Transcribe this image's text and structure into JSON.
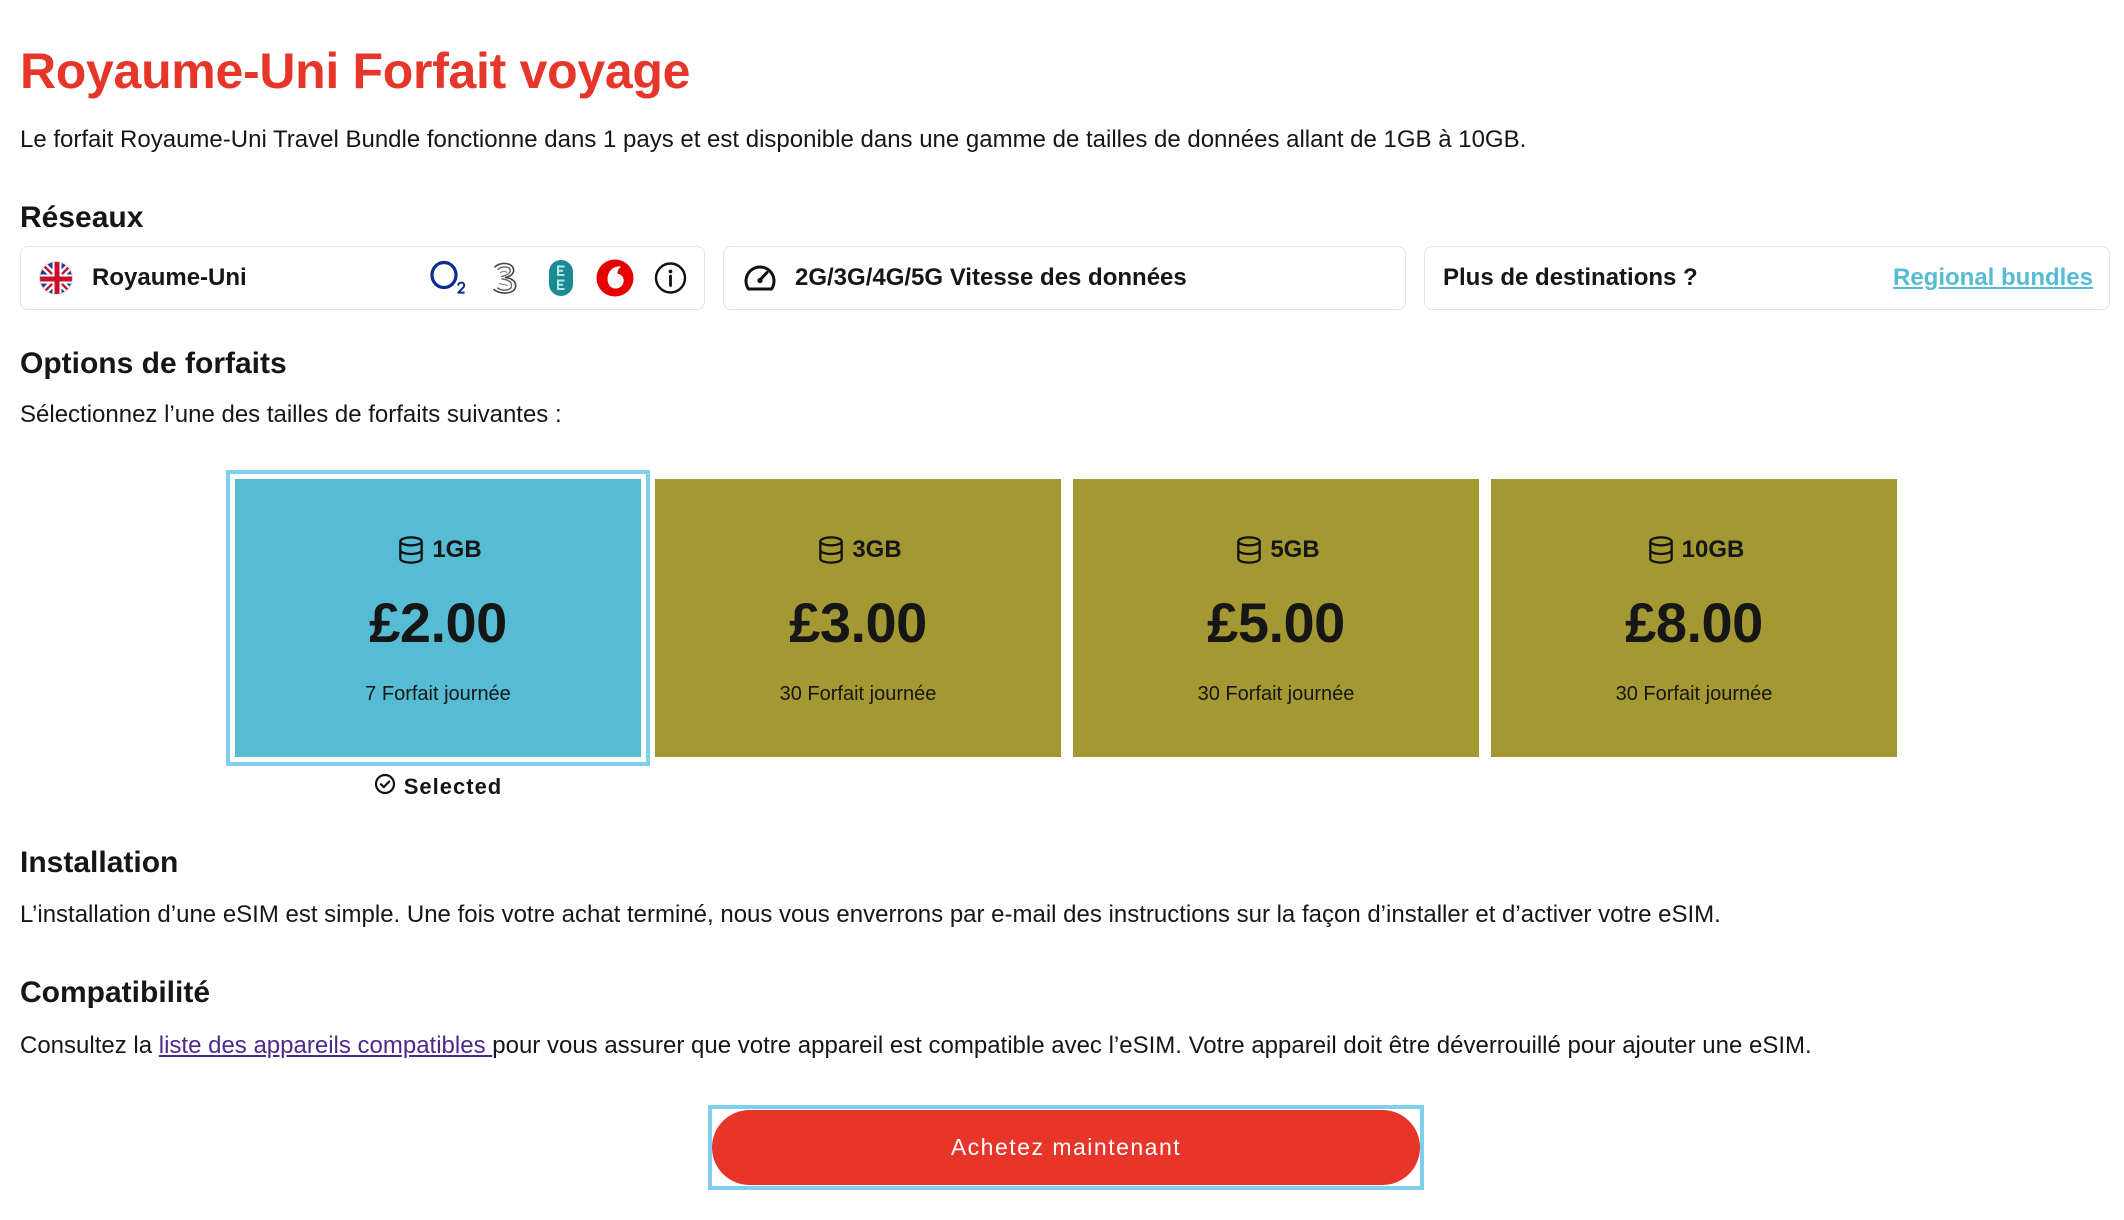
{
  "page": {
    "title": "Royaume-Uni Forfait voyage",
    "description": "Le forfait Royaume-Uni Travel Bundle fonctionne dans 1 pays et est disponible dans une gamme de tailles de données allant de 1GB à 10GB."
  },
  "colors": {
    "title_red": "#e6362a",
    "button_red": "#e8352a",
    "selected_plan": "#56bcd4",
    "plan_default": "#a49833",
    "focus_outline": "#7fd0ee",
    "regional_link": "#56bcd4",
    "compat_link": "#4c2a8a"
  },
  "networks": {
    "heading": "Réseaux",
    "country": "Royaume-Uni",
    "country_flag_icon": "uk-flag-icon",
    "operators": [
      {
        "icon": "o2-logo-icon",
        "logo_text": "O2"
      },
      {
        "icon": "three-logo-icon",
        "logo_text": "3"
      },
      {
        "icon": "ee-logo-icon",
        "logo_text": "EE"
      },
      {
        "icon": "vodafone-logo-icon"
      }
    ],
    "info_icon": "info-icon",
    "speed_icon": "speedometer-icon",
    "speed_label": "2G/3G/4G/5G Vitesse des données",
    "more_label": "Plus de destinations ?",
    "regional_link": "Regional bundles"
  },
  "plans": {
    "heading": "Options de forfaits",
    "instruction": "Sélectionnez l’une des tailles de forfaits suivantes :",
    "size_icon": "database-icon",
    "selected_index": 0,
    "selected_label": "Selected",
    "selected_icon": "check-circle-icon",
    "items": [
      {
        "size": "1GB",
        "price": "£2.00",
        "validity": "7 Forfait journée"
      },
      {
        "size": "3GB",
        "price": "£3.00",
        "validity": "30 Forfait journée"
      },
      {
        "size": "5GB",
        "price": "£5.00",
        "validity": "30 Forfait journée"
      },
      {
        "size": "10GB",
        "price": "£8.00",
        "validity": "30 Forfait journée"
      }
    ]
  },
  "installation": {
    "heading": "Installation",
    "text": "L’installation d’une eSIM est simple. Une fois votre achat terminé, nous vous enverrons par e-mail des instructions sur la façon d’installer et d’activer votre eSIM."
  },
  "compatibility": {
    "heading": "Compatibilité",
    "text_before": "Consultez la ",
    "link": "liste des appareils compatibles ",
    "text_after": "pour vous assurer que votre appareil est compatible avec l’eSIM. Votre appareil doit être déverrouillé pour ajouter une eSIM."
  },
  "cta": {
    "label": "Achetez maintenant"
  }
}
